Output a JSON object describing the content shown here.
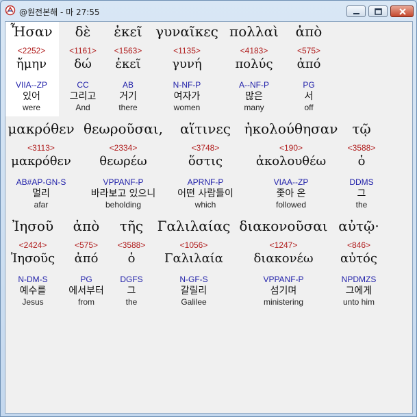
{
  "window": {
    "title": "@원전본해 - 마 27:55"
  },
  "lines": [
    {
      "words": [
        {
          "greek": "Ἦσαν",
          "strong": "<2252>",
          "lemma": "ἤμην",
          "parse": "VIIA--ZP",
          "korean": "있어",
          "english": "were"
        },
        {
          "greek": "δὲ",
          "strong": "<1161>",
          "lemma": "δώ",
          "parse": "CC",
          "korean": "그리고",
          "english": "And"
        },
        {
          "greek": "ἐκεῖ",
          "strong": "<1563>",
          "lemma": "ἐκεῖ",
          "parse": "AB",
          "korean": "거기",
          "english": "there"
        },
        {
          "greek": "γυναῖκες",
          "strong": "<1135>",
          "lemma": "γυνή",
          "parse": "N-NF-P",
          "korean": "여자가",
          "english": "women"
        },
        {
          "greek": "πολλαὶ",
          "strong": "<4183>",
          "lemma": "πολύς",
          "parse": "A--NF-P",
          "korean": "많은",
          "english": "many"
        },
        {
          "greek": "ἀπὸ",
          "strong": "<575>",
          "lemma": "ἀπό",
          "parse": "PG",
          "korean": "서",
          "english": "off"
        }
      ]
    },
    {
      "words": [
        {
          "greek": "μακρόθεν",
          "strong": "<3113>",
          "lemma": "μακρόθεν",
          "parse": "AB#AP-GN-S",
          "korean": "멀리",
          "english": "afar"
        },
        {
          "greek": "θεωροῦσαι,",
          "strong": "<2334>",
          "lemma": "θεωρέω",
          "parse": "VPPANF-P",
          "korean": "바라보고 있으니",
          "english": "beholding"
        },
        {
          "greek": "αἵτινες",
          "strong": "<3748>",
          "lemma": "ὅστις",
          "parse": "APRNF-P",
          "korean": "어떤 사람들이",
          "english": "which"
        },
        {
          "greek": "ἠκολούθησαν",
          "strong": "<190>",
          "lemma": "ἀκολουθέω",
          "parse": "VIAA--ZP",
          "korean": "좇아 온",
          "english": "followed"
        },
        {
          "greek": "τῷ",
          "strong": "<3588>",
          "lemma": "ὁ",
          "parse": "DDMS",
          "korean": "그",
          "english": "the"
        }
      ]
    },
    {
      "words": [
        {
          "greek": "Ἰησοῦ",
          "strong": "<2424>",
          "lemma": "Ἰησοῦς",
          "parse": "N-DM-S",
          "korean": "예수를",
          "english": "Jesus"
        },
        {
          "greek": "ἀπὸ",
          "strong": "<575>",
          "lemma": "ἀπό",
          "parse": "PG",
          "korean": "에서부터",
          "english": "from"
        },
        {
          "greek": "τῆς",
          "strong": "<3588>",
          "lemma": "ὁ",
          "parse": "DGFS",
          "korean": "그",
          "english": "the"
        },
        {
          "greek": "Γαλιλαίας",
          "strong": "<1056>",
          "lemma": "Γαλιλαία",
          "parse": "N-GF-S",
          "korean": "갈릴리",
          "english": "Galilee"
        },
        {
          "greek": "διακονοῦσαι",
          "strong": "<1247>",
          "lemma": "διακονέω",
          "parse": "VPPANF-P",
          "korean": "섬기며",
          "english": "ministering"
        },
        {
          "greek": "αὐτῷ·",
          "strong": "<846>",
          "lemma": "αὐτός",
          "parse": "NPDMZS",
          "korean": "그에게",
          "english": "unto him"
        }
      ]
    }
  ],
  "colors": {
    "strong": "#b01c1c",
    "parse": "#2222aa",
    "text": "#111111"
  }
}
